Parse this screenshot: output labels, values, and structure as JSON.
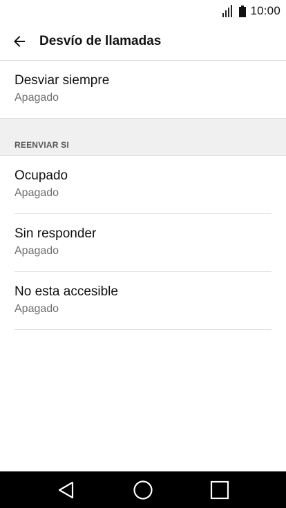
{
  "status_bar": {
    "time": "10:00",
    "signal_icon": "signal-bars-icon",
    "battery_icon": "battery-icon"
  },
  "header": {
    "title": "Desvío de llamadas",
    "back_icon": "arrow-back-icon"
  },
  "main": {
    "always": {
      "title": "Desviar siempre",
      "status": "Apagado"
    },
    "section_header": "REENVIAR SI",
    "conditions": [
      {
        "title": "Ocupado",
        "status": "Apagado"
      },
      {
        "title": "Sin responder",
        "status": "Apagado"
      },
      {
        "title": "No esta accesible",
        "status": "Apagado"
      }
    ]
  },
  "nav_bar": {
    "back_icon": "nav-back-triangle-icon",
    "home_icon": "nav-home-circle-icon",
    "recents_icon": "nav-recents-square-icon"
  },
  "colors": {
    "text_primary": "#111111",
    "text_secondary": "#6e6e6e",
    "section_bg": "#f0f0f0",
    "nav_bg": "#000000"
  }
}
